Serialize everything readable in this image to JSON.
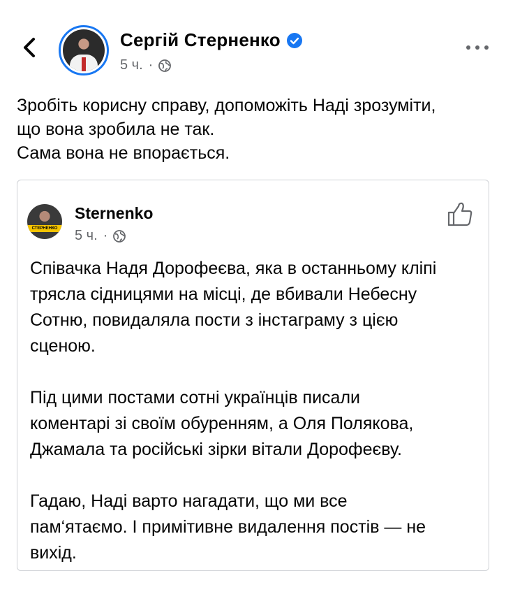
{
  "header": {
    "author_name": "Сергій Стерненко",
    "time": "5 ч.",
    "separator": "·",
    "icons": [
      "back-arrow-icon",
      "verified-badge-icon",
      "globe-icon",
      "more-dots-icon"
    ],
    "verified_color": "#1877f2"
  },
  "post": {
    "lines": [
      "Зробіть корисну справу, допоможіть Наді зрозуміти,",
      "що вона зробила не так.",
      "Сама вона не впорається."
    ]
  },
  "shared": {
    "author_name": "Sternenko",
    "avatar_badge": "СТЕРНЕНКО",
    "time": "5 ч.",
    "separator": "·",
    "icons": [
      "globe-icon",
      "thumbs-up-icon"
    ],
    "paragraphs": [
      [
        "Співачка Надя Дорофеєва, яка в останньому кліпі",
        "трясла сідницями на місці, де вбивали Небесну",
        "Сотню, повидаляла пости з інстаграму з цією",
        "сценою."
      ],
      [
        "Під цими постами сотні українців писали",
        "коментарі зі своїм обуренням, а Оля Полякова,",
        "Джамала та російські зірки вітали Дорофеєву."
      ],
      [
        "Гадаю, Наді варто нагадати, що ми все",
        "пам‘ятаємо. І примітивне видалення постів — не",
        "вихід."
      ]
    ]
  }
}
